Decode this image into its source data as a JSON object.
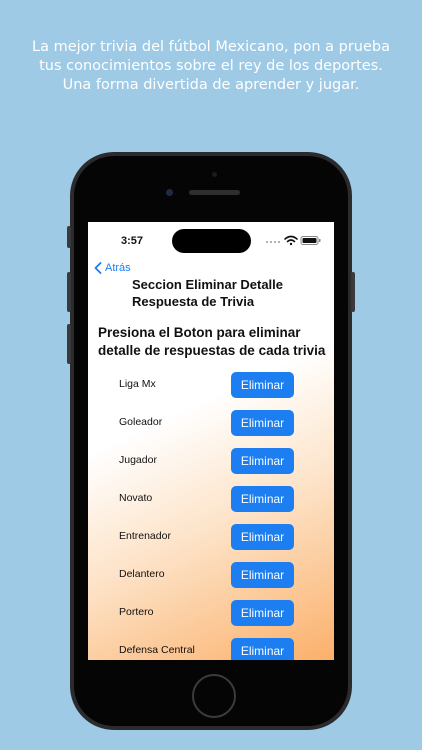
{
  "promo": {
    "lines": [
      "La mejor trivia del fútbol Mexicano, pon a prueba",
      "tus conocimientos sobre el rey de los deportes.",
      "Una forma divertida de aprender y jugar."
    ]
  },
  "status_bar": {
    "time": "3:57"
  },
  "nav": {
    "back_label": "Atrás"
  },
  "page": {
    "title": "Seccion Eliminar Detalle Respuesta de Trivia",
    "instruction": "Presiona el Boton para eliminar detalle de respuestas de cada trivia"
  },
  "rows": [
    {
      "label": "Liga Mx",
      "button": "Eliminar"
    },
    {
      "label": "Goleador",
      "button": "Eliminar"
    },
    {
      "label": "Jugador",
      "button": "Eliminar"
    },
    {
      "label": "Novato",
      "button": "Eliminar"
    },
    {
      "label": "Entrenador",
      "button": "Eliminar"
    },
    {
      "label": "Delantero",
      "button": "Eliminar"
    },
    {
      "label": "Portero",
      "button": "Eliminar"
    },
    {
      "label": "Defensa Central",
      "button": "Eliminar"
    }
  ],
  "colors": {
    "background": "#9ecae6",
    "accent": "#1c7ef0",
    "gradient_end": "#fbb06a"
  }
}
